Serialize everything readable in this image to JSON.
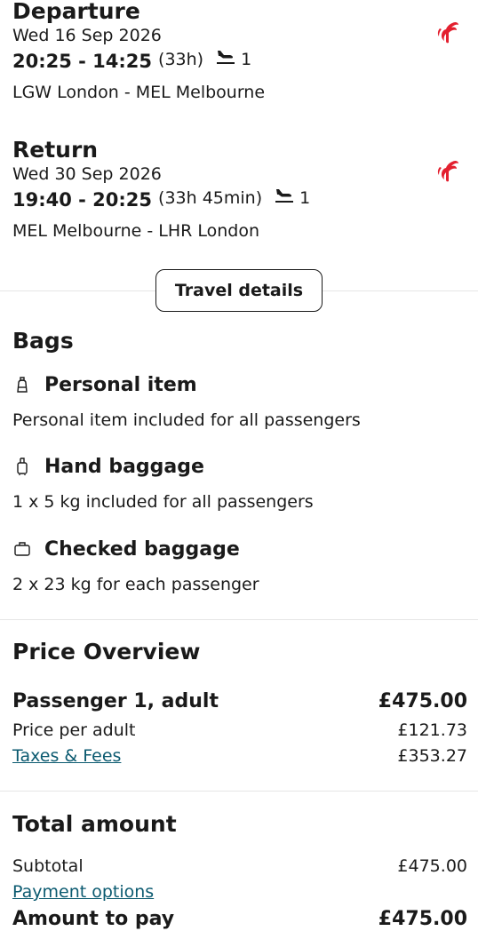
{
  "departure": {
    "title": "Departure",
    "date": "Wed 16 Sep 2026",
    "times": "20:25 - 14:25",
    "duration": "(33h)",
    "stops": "1",
    "route": "LGW London - MEL Melbourne",
    "airline_icon": "air-china-logo"
  },
  "return": {
    "title": "Return",
    "date": "Wed 30 Sep 2026",
    "times": "19:40 - 20:25",
    "duration": "(33h 45min)",
    "stops": "1",
    "route": "MEL Melbourne - LHR London",
    "airline_icon": "air-china-logo"
  },
  "travel_details_button": "Travel details",
  "bags": {
    "title": "Bags",
    "items": [
      {
        "icon": "personal-item-icon",
        "title": "Personal item",
        "desc": "Personal item included for all passengers"
      },
      {
        "icon": "hand-baggage-icon",
        "title": "Hand baggage",
        "desc": "1 x 5 kg included for all passengers"
      },
      {
        "icon": "checked-baggage-icon",
        "title": "Checked baggage",
        "desc": "2 x 23 kg for each passenger"
      }
    ]
  },
  "price": {
    "title": "Price Overview",
    "passenger_label": "Passenger 1, adult",
    "passenger_total": "£475.00",
    "per_adult_label": "Price per adult",
    "per_adult_value": "£121.73",
    "taxes_label": "Taxes & Fees",
    "taxes_value": "£353.27"
  },
  "total": {
    "title": "Total amount",
    "subtotal_label": "Subtotal",
    "subtotal_value": "£475.00",
    "payment_options_label": "Payment options",
    "amount_label": "Amount to pay",
    "amount_value": "£475.00"
  },
  "colors": {
    "airline_red": "#e3202f",
    "link": "#0b5a70",
    "text": "#1a1a1a",
    "divider": "#e6e6e6"
  }
}
